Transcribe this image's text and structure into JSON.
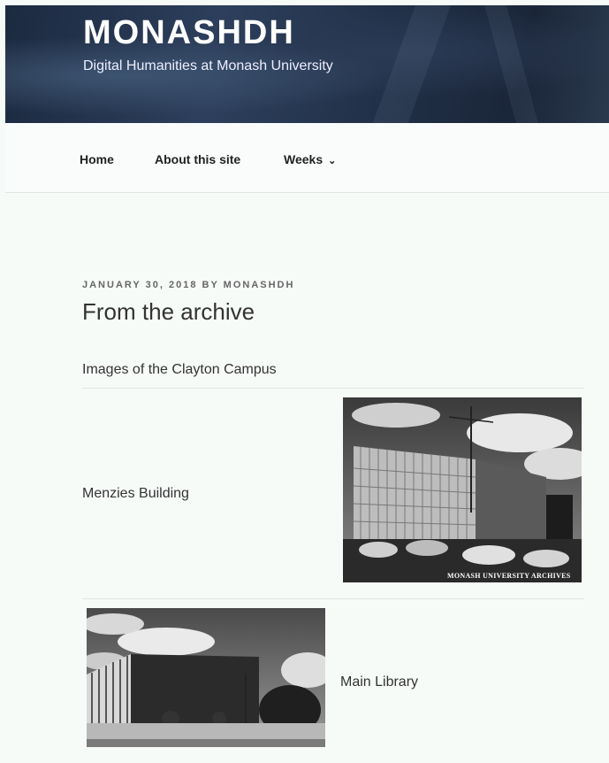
{
  "site": {
    "title": "MONASHDH",
    "description": "Digital Humanities at Monash University"
  },
  "nav": {
    "items": [
      {
        "label": "Home"
      },
      {
        "label": "About this site"
      },
      {
        "label": "Weeks",
        "icon": "chevron-down-icon"
      }
    ]
  },
  "post": {
    "date": "JANUARY 30, 2018",
    "by": "BY",
    "author": "MONASHDH",
    "title": "From the archive",
    "subtitle": "Images of the Clayton Campus",
    "gallery": [
      {
        "caption": "Menzies Building",
        "watermark": "MONASH UNIVERSITY ARCHIVES"
      },
      {
        "caption": "Main Library"
      }
    ]
  }
}
